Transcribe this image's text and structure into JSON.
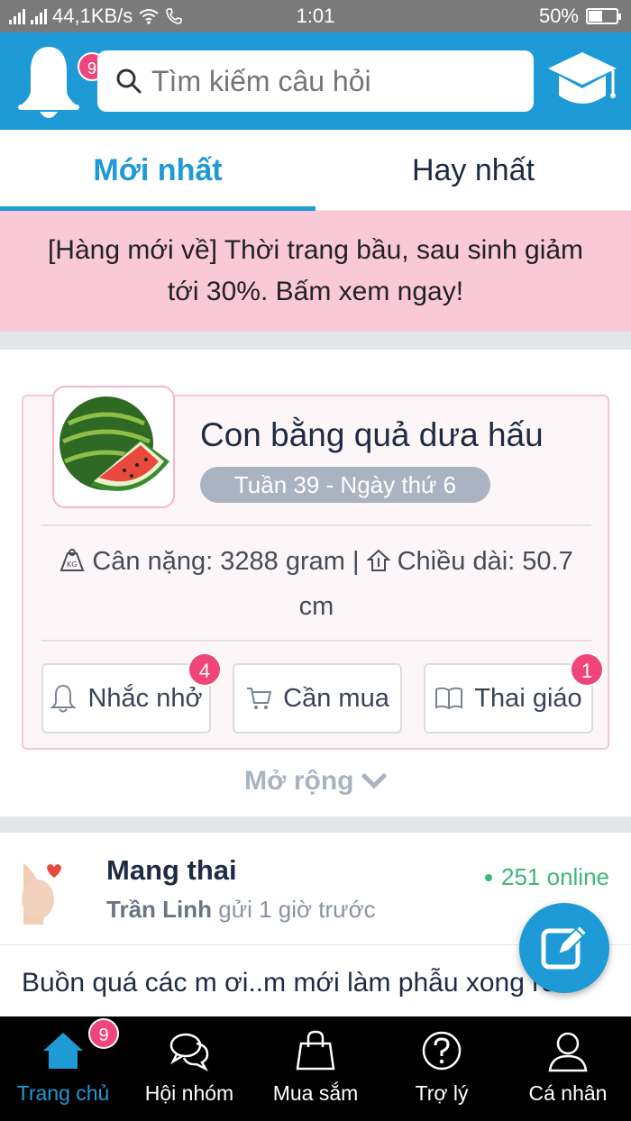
{
  "status_bar": {
    "speed": "44,1KB/s",
    "time": "1:01",
    "battery": "50%",
    "battery_level": 0.5
  },
  "header": {
    "notification_count": "9",
    "search_placeholder": "Tìm kiếm câu hỏi"
  },
  "tabs": [
    {
      "label": "Mới nhất",
      "active": true
    },
    {
      "label": "Hay nhất",
      "active": false
    }
  ],
  "promo": {
    "text": "[Hàng mới về] Thời trang bầu, sau sinh giảm tới 30%. Bấm xem ngay!"
  },
  "baby_card": {
    "title": "Con bằng quả dưa hấu",
    "week": "Tuần 39 - Ngày thứ 6",
    "weight": "Cân nặng: 3288 gram |",
    "length": "Chiều dài: 50.7 cm",
    "buttons": [
      {
        "label": "Nhắc nhở",
        "icon": "bell-icon",
        "badge": "4"
      },
      {
        "label": "Cần mua",
        "icon": "cart-icon",
        "badge": ""
      },
      {
        "label": "Thai giáo",
        "icon": "book-icon",
        "badge": "1"
      }
    ],
    "expand": "Mở rộng"
  },
  "post": {
    "group": "Mang thai",
    "author": "Trần Linh",
    "time": "gửi 1 giờ trước",
    "online": "251 online",
    "text": "Buồn quá các m ơi..m mới làm phẫu xong rồi"
  },
  "bottom_nav": [
    {
      "label": "Trang chủ",
      "icon": "home-icon",
      "active": true,
      "badge": "9"
    },
    {
      "label": "Hội nhóm",
      "icon": "chat-icon",
      "active": false
    },
    {
      "label": "Mua sắm",
      "icon": "shopping-bag-icon",
      "active": false
    },
    {
      "label": "Trợ lý",
      "icon": "help-icon",
      "active": false
    },
    {
      "label": "Cá nhân",
      "icon": "user-icon",
      "active": false
    }
  ],
  "colors": {
    "primary": "#1e9ad6",
    "promo_bg": "#f9c9d8",
    "badge": "#f0457a",
    "online": "#3cb878"
  }
}
